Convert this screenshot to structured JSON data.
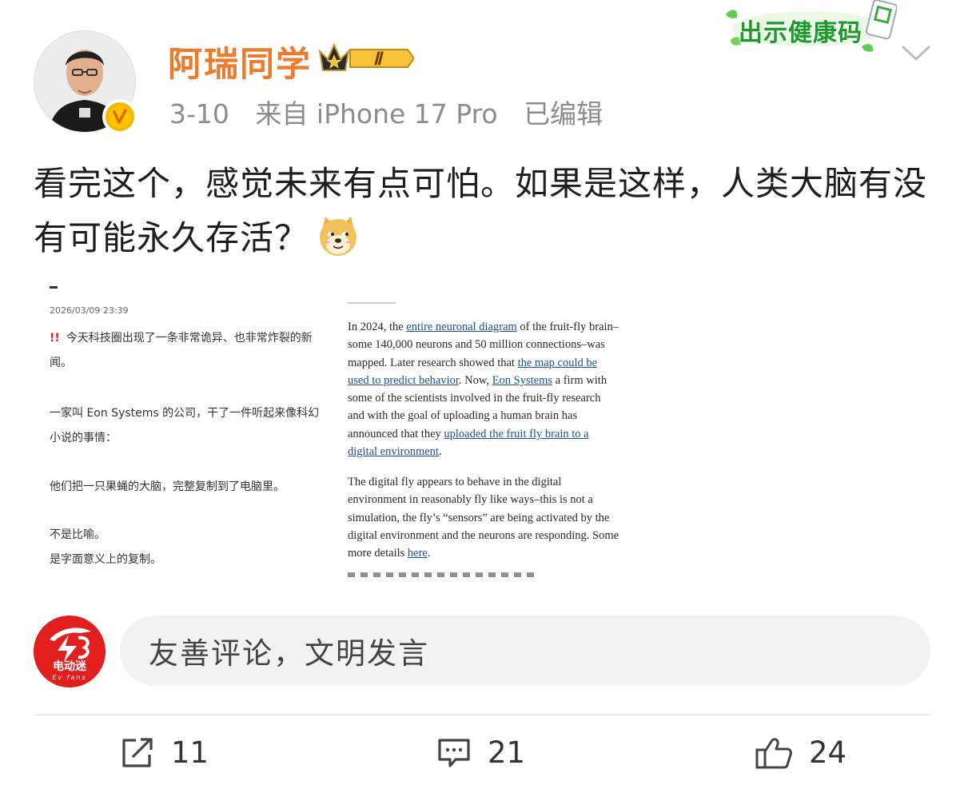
{
  "header": {
    "username": "阿瑞同学",
    "level_badge": "Ⅱ",
    "date": "3-10",
    "source": "来自 iPhone 17 Pro",
    "edited": "已编辑",
    "health_code_label": "出示健康码"
  },
  "post": {
    "text": "看完这个，感觉未来有点可怕。如果是这样，人类大脑有没有可能永久存活？",
    "emoji": "doge-icon"
  },
  "image_left": {
    "date": "2026/03/09 23:39",
    "lines": [
      "今天科技圈出现了一条非常诡异、也非常炸裂的新闻。",
      "一家叫 Eon Systems 的公司，干了一件听起来像科幻小说的事情：",
      "他们把一只果蝇的大脑，完整复制到了电脑里。",
      "不是比喻。",
      "是字面意义上的复制。"
    ]
  },
  "image_right": {
    "p1_a": "In 2024, the ",
    "p1_link1": "entire neuronal diagram",
    "p1_b": " of the fruit-fly brain–some 140,000 neurons and 50 million connections–was mapped. Later research showed that ",
    "p1_link2": "the map could be used to predict behavior",
    "p1_c": ". Now, ",
    "p1_link3": "Eon Systems",
    "p1_d": " a firm with some of the scientists involved in the fruit-fly research and with the goal of uploading a human brain has announced that they ",
    "p1_link4": "uploaded the fruit fly brain to a digital environment",
    "p1_e": ".",
    "p2_a": "The digital fly appears to behave in the digital environment in reasonably fly like ways–this is not a simulation, the fly’s “sensors” are being activated by the digital environment and the neurons are responding. Some more details ",
    "p2_link": "here",
    "p2_b": "."
  },
  "comment": {
    "brand_name": "电动迷",
    "brand_sub": "Ev fans",
    "placeholder": "友善评论，文明发言"
  },
  "actions": {
    "repost_count": "11",
    "comment_count": "21",
    "like_count": "24"
  },
  "colors": {
    "username": "#ee7a2c",
    "meta": "#8c8c8c",
    "link": "#1e4f9c",
    "brand_red": "#e21f1f",
    "health_green": "#1c9b2a"
  }
}
